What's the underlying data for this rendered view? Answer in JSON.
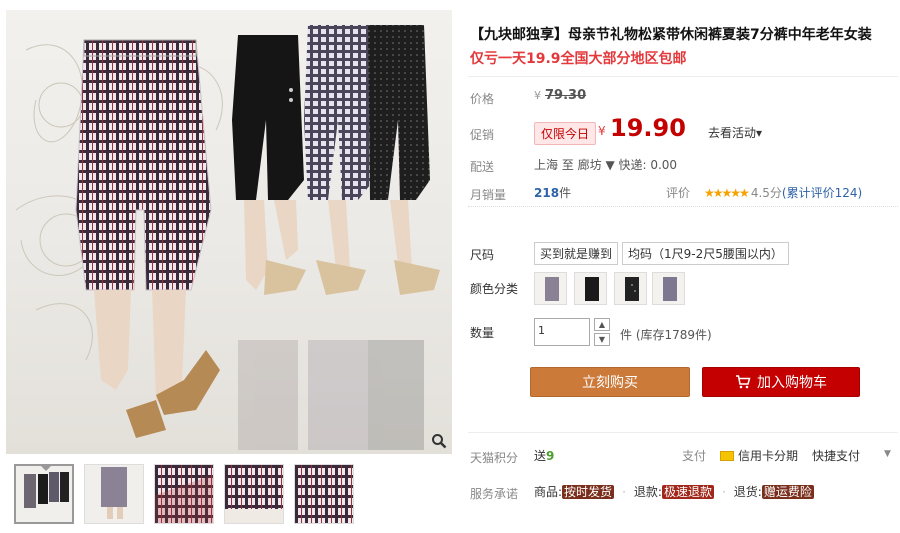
{
  "gallery": {
    "zoom_icon": "magnifier-icon",
    "thumbnail_count": 5
  },
  "product": {
    "title": "【九块邮独享】母亲节礼物松紧带休闲裤夏装7分裤中年老年女装",
    "subtitle": "仅亏一天19.9全国大部分地区包邮"
  },
  "price": {
    "label": "价格",
    "currency": "¥",
    "original": "79.30"
  },
  "promo": {
    "label": "促销",
    "badge": "仅限今日",
    "currency": "¥",
    "price": "19.90",
    "more": "去看活动▾"
  },
  "shipping": {
    "label": "配送",
    "text": "上海  至  廊坊 ▼  快递: 0.00"
  },
  "sales": {
    "label": "月销量",
    "count": "218",
    "unit": "件",
    "rating_label": "评价",
    "stars": "★★★★★",
    "rating_text": "4.5分",
    "reviews_link": "(累计评价124)"
  },
  "size": {
    "label": "尺码",
    "options": [
      "买到就是赚到",
      "均码（1尺9-2尺5腰围以内）"
    ]
  },
  "color": {
    "label": "颜色分类"
  },
  "quantity": {
    "label": "数量",
    "value": "1",
    "up": "▲",
    "down": "▼",
    "stock": "件 (库存1789件)"
  },
  "actions": {
    "buy_label": "立刻购买",
    "cart_label": "加入购物车",
    "cart_icon": "cart-icon"
  },
  "points": {
    "label": "天猫积分",
    "prefix": "送",
    "value": "9"
  },
  "payment": {
    "label": "支付",
    "card_text": "信用卡分期",
    "quick": "快捷支付",
    "caret": "▼"
  },
  "service": {
    "label": "服务承诺",
    "goods_prefix": "商品:",
    "goods_tag": "按时发货",
    "refund_prefix": "退款:",
    "refund_tag": "极速退款",
    "return_prefix": "退货:",
    "return_tag": "赠运费险",
    "dot": "·"
  },
  "colors": {
    "price_red": "#c40000",
    "buy_orange": "#cc7a3a",
    "cart_red": "#c40000",
    "link_blue": "#2e63a8"
  }
}
